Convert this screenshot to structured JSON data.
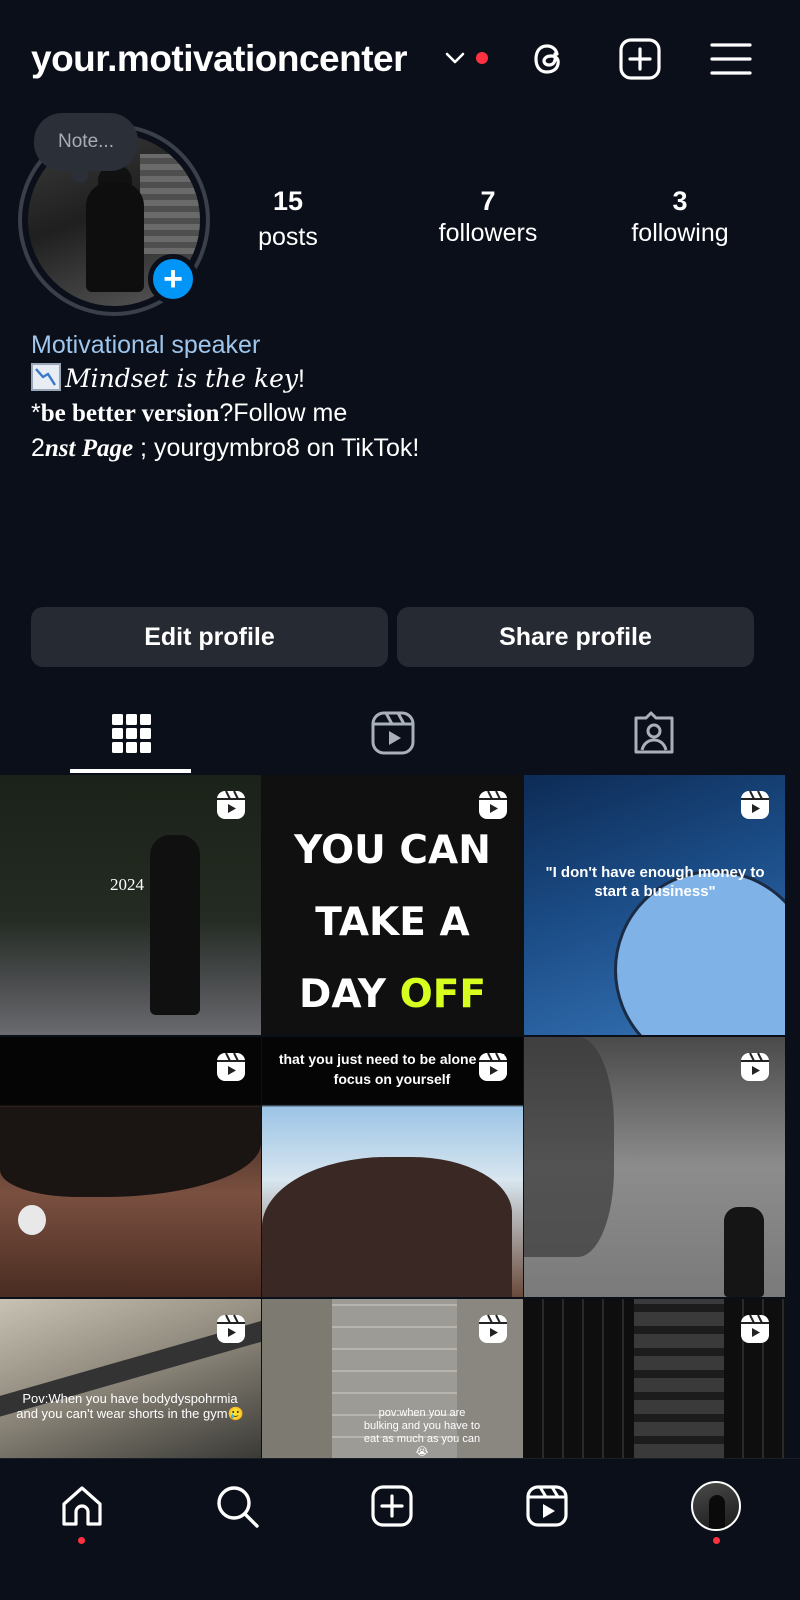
{
  "header": {
    "username": "your.motivationcenter",
    "icons": [
      "chevron-down-icon",
      "threads-icon",
      "create-icon",
      "menu-icon"
    ]
  },
  "profile": {
    "note_placeholder": "Note...",
    "stats": [
      {
        "value": "15",
        "label": "posts"
      },
      {
        "value": "7",
        "label": "followers"
      },
      {
        "value": "3",
        "label": "following"
      }
    ]
  },
  "bio": {
    "category": "Motivational speaker",
    "line1_script": "Mindset is the key",
    "line1_end": "!",
    "line2_prefix": "*",
    "line2_bold": "be better version",
    "line2_rest": "?Follow me",
    "line3_num": "2",
    "line3_bolditalic": "nst Page",
    "line3_rest": " ; yourgymbro8 on TikTok!"
  },
  "buttons": {
    "edit": "Edit profile",
    "share": "Share profile"
  },
  "tabs": [
    "grid-icon",
    "reels-icon",
    "tagged-icon"
  ],
  "grid": [
    {
      "text": "2024",
      "reel": true
    },
    {
      "text_lines": [
        "YOU CAN",
        "TAKE A",
        "DAY"
      ],
      "highlight": "OFF",
      "reel": true
    },
    {
      "text": "\"I don't have enough money to start a business\"",
      "reel": true
    },
    {
      "text": "",
      "reel": true
    },
    {
      "text_top": "that you just need to be alone and focus on yourself",
      "reel": true
    },
    {
      "text": "",
      "reel": true
    },
    {
      "text": "Pov:When you have bodydyspohrmia and you can't wear shorts in the gym🥲",
      "reel": true
    },
    {
      "text": "pov:when you are bulking and you have to eat as much as you can😭",
      "reel": true
    },
    {
      "text": "",
      "reel": true
    }
  ],
  "bottom_nav": [
    "home-icon",
    "search-icon",
    "create-icon",
    "reels-icon",
    "profile-avatar"
  ],
  "colors": {
    "background": "#0b0f19",
    "accent": "#0095f6",
    "notification": "#ff3040",
    "category_text": "#9fc6ec",
    "button_bg": "#262a33",
    "highlight_yellow": "#d6ff20"
  }
}
